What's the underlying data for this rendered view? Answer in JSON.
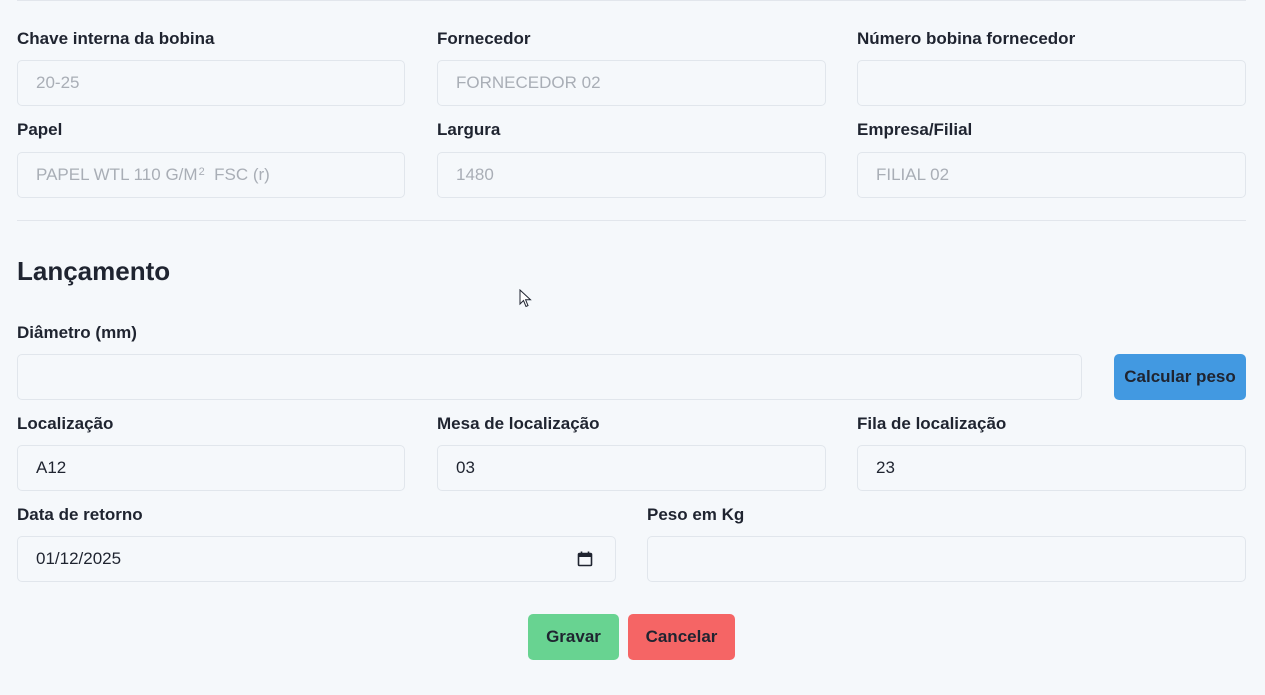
{
  "info": {
    "fields": [
      {
        "label": "Chave interna da bobina",
        "value": "20-25"
      },
      {
        "label": "Fornecedor",
        "value": "FORNECEDOR 02"
      },
      {
        "label": "Número bobina fornecedor",
        "value": ""
      },
      {
        "label": "Papel",
        "value": "PAPEL WTL 110 G/M",
        "value_sup": "2",
        "value_suffix": "  FSC (r)"
      },
      {
        "label": "Largura",
        "value": "1480"
      },
      {
        "label": "Empresa/Filial",
        "value": "FILIAL 02"
      }
    ]
  },
  "lancamento": {
    "title": "Lançamento",
    "diametro": {
      "label": "Diâmetro (mm)",
      "value": ""
    },
    "calcular_label": "Calcular peso",
    "localizacao": {
      "label": "Localização",
      "value": "A12"
    },
    "mesa": {
      "label": "Mesa de localização",
      "value": "03"
    },
    "fila": {
      "label": "Fila de localização",
      "value": "23"
    },
    "data_retorno": {
      "label": "Data de retorno",
      "value": "01/12/2025",
      "icon": "calendar-icon"
    },
    "peso": {
      "label": "Peso em Kg",
      "value": ""
    }
  },
  "actions": {
    "save_label": "Gravar",
    "cancel_label": "Cancelar"
  },
  "colors": {
    "background": "#f5f8fb",
    "calc_button": "#4299e1",
    "save_button": "#68d391",
    "cancel_button": "#f56565"
  }
}
